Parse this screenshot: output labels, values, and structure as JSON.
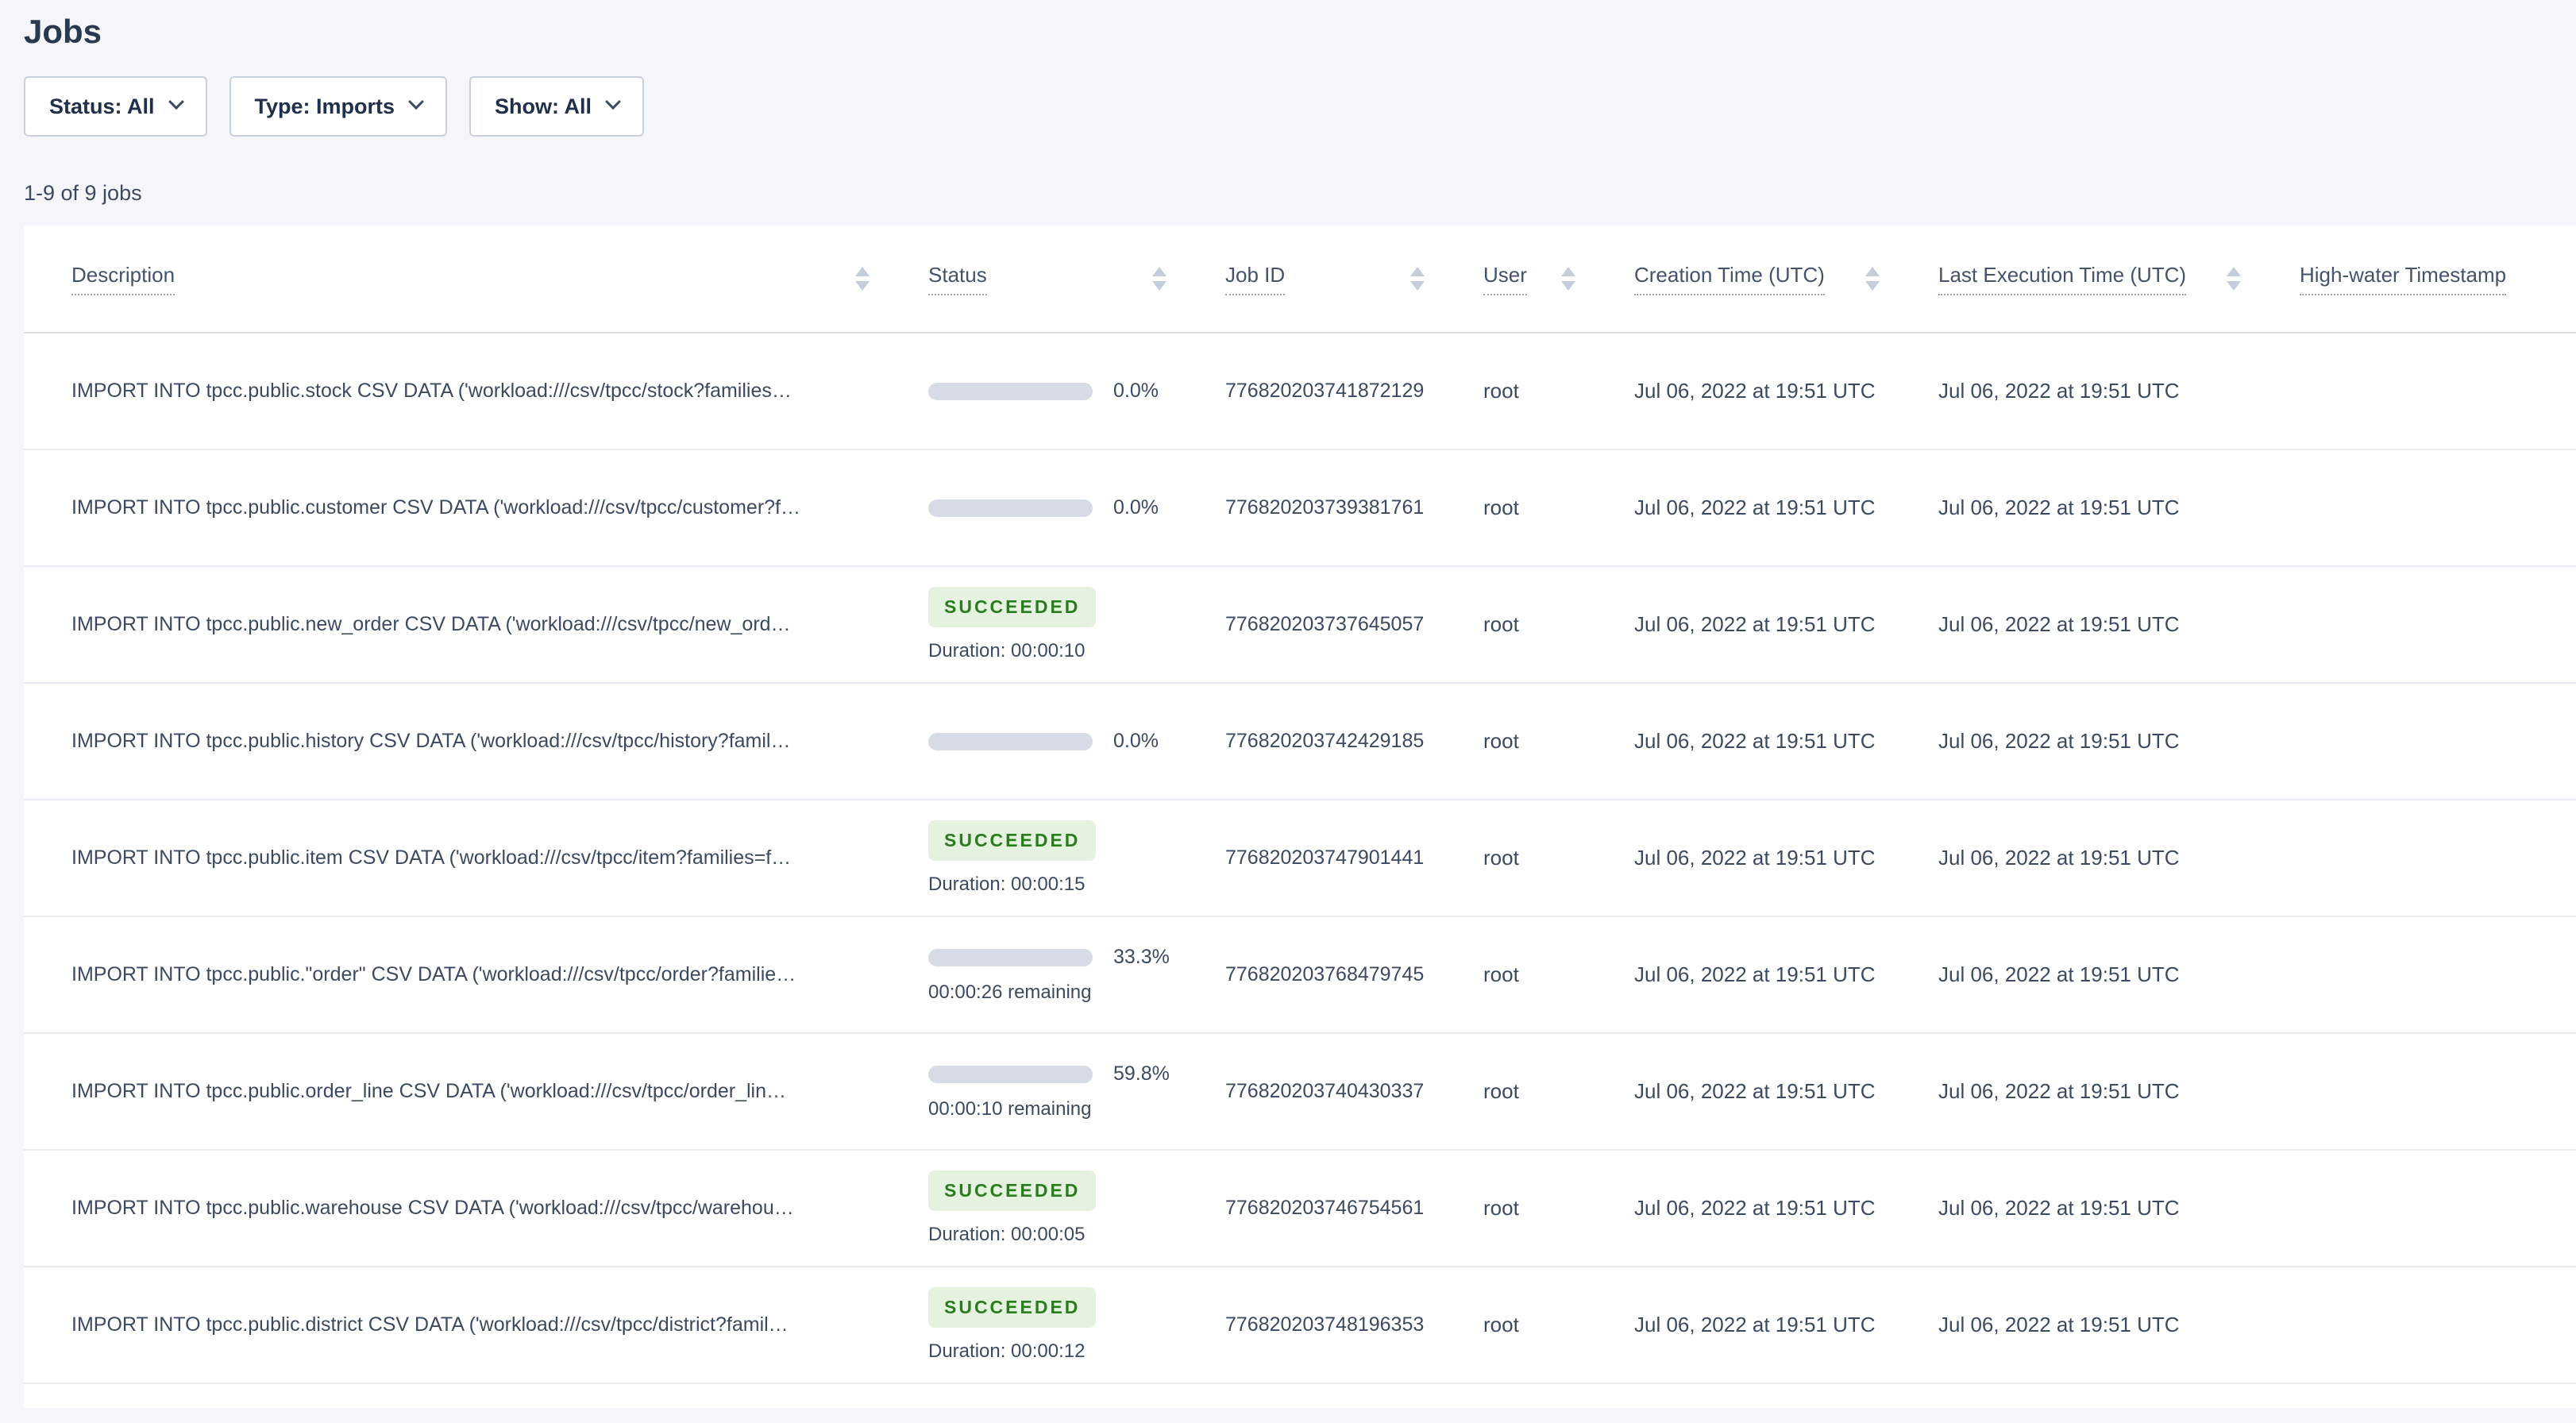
{
  "page": {
    "title": "Jobs",
    "jobs_count": "1-9 of 9 jobs"
  },
  "filters": {
    "status": "Status: All",
    "type": "Type: Imports",
    "show": "Show: All"
  },
  "table": {
    "columns": [
      {
        "label": "Description",
        "sort": "none"
      },
      {
        "label": "Status",
        "sort": "none"
      },
      {
        "label": "Job ID",
        "sort": "none"
      },
      {
        "label": "User",
        "sort": "none"
      },
      {
        "label": "Creation Time (UTC)",
        "sort": "none"
      },
      {
        "label": "Last Execution Time (UTC)",
        "sort": "none"
      },
      {
        "label": "High-water Timestamp",
        "sort": "desc"
      }
    ],
    "rows": [
      {
        "description": "IMPORT INTO tpcc.public.stock CSV DATA ('workload:///csv/tpcc/stock?families…",
        "status_type": "progress",
        "percent_label": "0.0%",
        "percent_value": 0,
        "remaining_label": "",
        "badge_label": "",
        "duration_label": "",
        "job_id": "776820203741872129",
        "user": "root",
        "creation_time": "Jul 06, 2022 at 19:51 UTC",
        "last_execution_time": "Jul 06, 2022 at 19:51 UTC",
        "high_water": ""
      },
      {
        "description": "IMPORT INTO tpcc.public.customer CSV DATA ('workload:///csv/tpcc/customer?f…",
        "status_type": "progress",
        "percent_label": "0.0%",
        "percent_value": 0,
        "remaining_label": "",
        "badge_label": "",
        "duration_label": "",
        "job_id": "776820203739381761",
        "user": "root",
        "creation_time": "Jul 06, 2022 at 19:51 UTC",
        "last_execution_time": "Jul 06, 2022 at 19:51 UTC",
        "high_water": ""
      },
      {
        "description": "IMPORT INTO tpcc.public.new_order CSV DATA ('workload:///csv/tpcc/new_ord…",
        "status_type": "succeeded",
        "percent_label": "",
        "percent_value": 0,
        "remaining_label": "",
        "badge_label": "SUCCEEDED",
        "duration_label": "Duration: 00:00:10",
        "job_id": "776820203737645057",
        "user": "root",
        "creation_time": "Jul 06, 2022 at 19:51 UTC",
        "last_execution_time": "Jul 06, 2022 at 19:51 UTC",
        "high_water": ""
      },
      {
        "description": "IMPORT INTO tpcc.public.history CSV DATA ('workload:///csv/tpcc/history?famil…",
        "status_type": "progress",
        "percent_label": "0.0%",
        "percent_value": 0,
        "remaining_label": "",
        "badge_label": "",
        "duration_label": "",
        "job_id": "776820203742429185",
        "user": "root",
        "creation_time": "Jul 06, 2022 at 19:51 UTC",
        "last_execution_time": "Jul 06, 2022 at 19:51 UTC",
        "high_water": ""
      },
      {
        "description": "IMPORT INTO tpcc.public.item CSV DATA ('workload:///csv/tpcc/item?families=f…",
        "status_type": "succeeded",
        "percent_label": "",
        "percent_value": 0,
        "remaining_label": "",
        "badge_label": "SUCCEEDED",
        "duration_label": "Duration: 00:00:15",
        "job_id": "776820203747901441",
        "user": "root",
        "creation_time": "Jul 06, 2022 at 19:51 UTC",
        "last_execution_time": "Jul 06, 2022 at 19:51 UTC",
        "high_water": ""
      },
      {
        "description": "IMPORT INTO tpcc.public.\"order\" CSV DATA ('workload:///csv/tpcc/order?familie…",
        "status_type": "progress",
        "percent_label": "33.3%",
        "percent_value": 33.3,
        "remaining_label": "00:00:26 remaining",
        "badge_label": "",
        "duration_label": "",
        "job_id": "776820203768479745",
        "user": "root",
        "creation_time": "Jul 06, 2022 at 19:51 UTC",
        "last_execution_time": "Jul 06, 2022 at 19:51 UTC",
        "high_water": ""
      },
      {
        "description": "IMPORT INTO tpcc.public.order_line CSV DATA ('workload:///csv/tpcc/order_lin…",
        "status_type": "progress",
        "percent_label": "59.8%",
        "percent_value": 59.8,
        "remaining_label": "00:00:10 remaining",
        "badge_label": "",
        "duration_label": "",
        "job_id": "776820203740430337",
        "user": "root",
        "creation_time": "Jul 06, 2022 at 19:51 UTC",
        "last_execution_time": "Jul 06, 2022 at 19:51 UTC",
        "high_water": ""
      },
      {
        "description": "IMPORT INTO tpcc.public.warehouse CSV DATA ('workload:///csv/tpcc/warehou…",
        "status_type": "succeeded",
        "percent_label": "",
        "percent_value": 0,
        "remaining_label": "",
        "badge_label": "SUCCEEDED",
        "duration_label": "Duration: 00:00:05",
        "job_id": "776820203746754561",
        "user": "root",
        "creation_time": "Jul 06, 2022 at 19:51 UTC",
        "last_execution_time": "Jul 06, 2022 at 19:51 UTC",
        "high_water": ""
      },
      {
        "description": "IMPORT INTO tpcc.public.district CSV DATA ('workload:///csv/tpcc/district?famil…",
        "status_type": "succeeded",
        "percent_label": "",
        "percent_value": 0,
        "remaining_label": "",
        "badge_label": "SUCCEEDED",
        "duration_label": "Duration: 00:00:12",
        "job_id": "776820203748196353",
        "user": "root",
        "creation_time": "Jul 06, 2022 at 19:51 UTC",
        "last_execution_time": "Jul 06, 2022 at 19:51 UTC",
        "high_water": ""
      }
    ]
  },
  "colors": {
    "page_bg": "#f4f6fa",
    "accent_blue": "#1d5cf2",
    "progress_track": "#d6dbe6",
    "success_text": "#2b7c1e",
    "success_bg": "#e4f2df",
    "text": "#3c4a61"
  }
}
